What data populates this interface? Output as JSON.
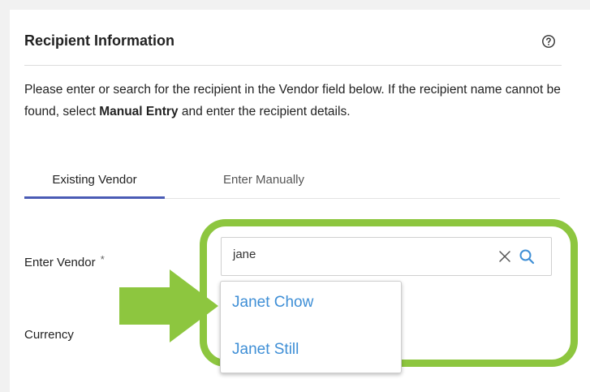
{
  "section": {
    "title": "Recipient Information",
    "help_icon": "question-circle-icon",
    "description_part1": "Please enter or search for the recipient in the Vendor field below. If the recipient name cannot be found, select ",
    "description_bold": "Manual Entry",
    "description_part2": " and enter the recipient details."
  },
  "tabs": [
    {
      "label": "Existing Vendor",
      "active": true
    },
    {
      "label": "Enter Manually",
      "active": false
    }
  ],
  "fields": {
    "vendor_label": "Enter Vendor",
    "required_mark": "*",
    "vendor_value": "jane",
    "currency_label": "Currency"
  },
  "suggestions": [
    {
      "label": "Janet Chow"
    },
    {
      "label": "Janet Still"
    }
  ],
  "colors": {
    "highlight": "#8dc63f",
    "link": "#3f8fd6",
    "tab_underline": "#4a5bb5"
  }
}
